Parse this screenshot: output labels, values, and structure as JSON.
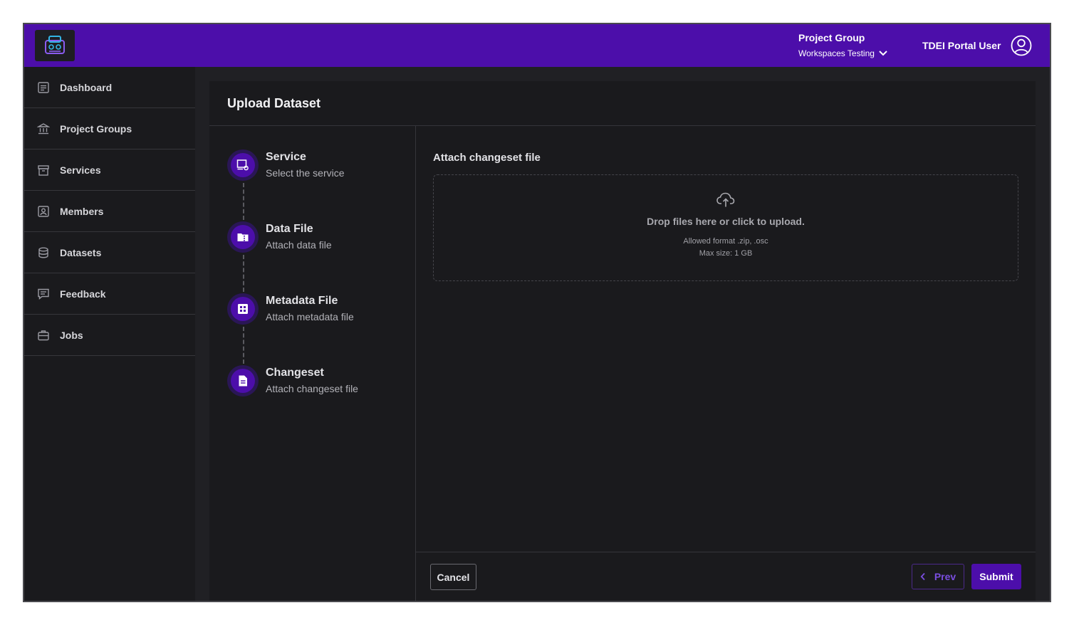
{
  "header": {
    "project_group_label": "Project Group",
    "workspace_name": "Workspaces Testing",
    "user_name": "TDEI Portal User"
  },
  "sidebar": {
    "items": [
      {
        "label": "Dashboard",
        "icon": "dashboard-icon"
      },
      {
        "label": "Project Groups",
        "icon": "bank-icon"
      },
      {
        "label": "Services",
        "icon": "archive-icon"
      },
      {
        "label": "Members",
        "icon": "member-badge-icon"
      },
      {
        "label": "Datasets",
        "icon": "database-icon"
      },
      {
        "label": "Feedback",
        "icon": "feedback-icon"
      },
      {
        "label": "Jobs",
        "icon": "briefcase-icon"
      }
    ]
  },
  "page": {
    "title": "Upload Dataset"
  },
  "steps": [
    {
      "title": "Service",
      "subtitle": "Select the service",
      "icon": "service-icon"
    },
    {
      "title": "Data File",
      "subtitle": "Attach data file",
      "icon": "folder-zip-icon"
    },
    {
      "title": "Metadata File",
      "subtitle": "Attach metadata file",
      "icon": "grid-icon"
    },
    {
      "title": "Changeset",
      "subtitle": "Attach changeset file",
      "icon": "document-icon"
    }
  ],
  "upload": {
    "label": "Attach changeset file",
    "drop_text": "Drop files here or click to upload.",
    "allowed_format": "Allowed format .zip, .osc",
    "max_size": "Max size: 1 GB"
  },
  "footer": {
    "cancel_label": "Cancel",
    "prev_label": "Prev",
    "submit_label": "Submit"
  },
  "colors": {
    "brand": "#4c0eaa",
    "background": "#18181b",
    "accent_text": "#7a4ee0"
  }
}
